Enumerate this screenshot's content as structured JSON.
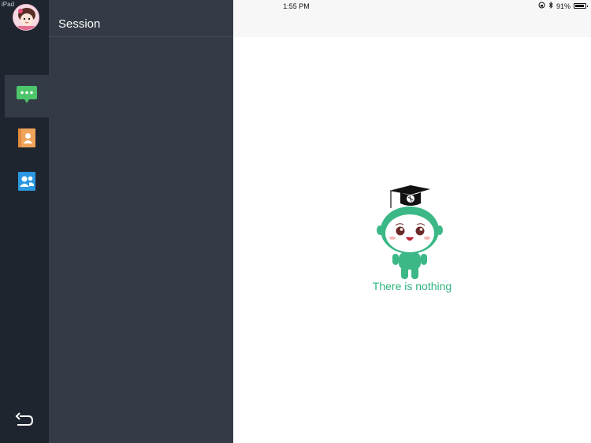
{
  "device": {
    "label": "iPad"
  },
  "statusbar": {
    "time": "1:55 PM",
    "battery_text": "91%",
    "battery_level": 0.91
  },
  "rail": {
    "items": [
      {
        "icon": "chat-bubble-icon",
        "color": "#4cc56b",
        "active": true
      },
      {
        "icon": "contact-card-icon",
        "color": "#f0a35a",
        "active": false
      },
      {
        "icon": "group-contacts-icon",
        "color": "#2a97e0",
        "active": false
      }
    ],
    "back_icon": "back-arrow-icon"
  },
  "panel": {
    "title": "Session"
  },
  "main": {
    "empty_text": "There is nothing"
  },
  "colors": {
    "rail_bg": "#1e252f",
    "panel_bg": "#343b46",
    "accent_green": "#2fb37e"
  }
}
